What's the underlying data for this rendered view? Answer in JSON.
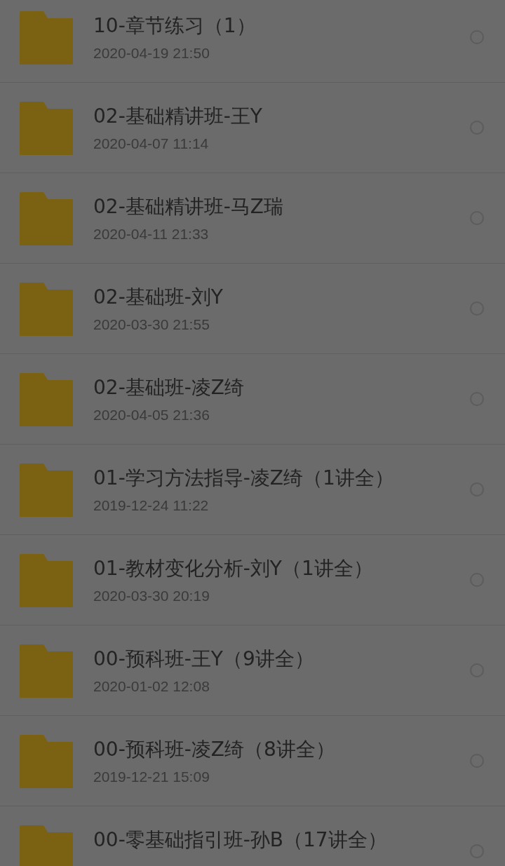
{
  "folders": [
    {
      "name": "10-章节练习（1）",
      "date": "2020-04-19  21:50",
      "selected": false
    },
    {
      "name": "02-基础精讲班-王Y",
      "date": "2020-04-07  11:14",
      "selected": false
    },
    {
      "name": "02-基础精讲班-马Z瑞",
      "date": "2020-04-11  21:33",
      "selected": false
    },
    {
      "name": "02-基础班-刘Y",
      "date": "2020-03-30  21:55",
      "selected": false
    },
    {
      "name": "02-基础班-凌Z绮",
      "date": "2020-04-05  21:36",
      "selected": false
    },
    {
      "name": "01-学习方法指导-凌Z绮（1讲全）",
      "date": "2019-12-24  11:22",
      "selected": false
    },
    {
      "name": "01-教材变化分析-刘Y（1讲全）",
      "date": "2020-03-30  20:19",
      "selected": false
    },
    {
      "name": "00-预科班-王Y（9讲全）",
      "date": "2020-01-02  12:08",
      "selected": false
    },
    {
      "name": "00-预科班-凌Z绮（8讲全）",
      "date": "2019-12-21  15:09",
      "selected": false
    },
    {
      "name": "00-零基础指引班-孙B（17讲全）",
      "selected": false
    }
  ]
}
